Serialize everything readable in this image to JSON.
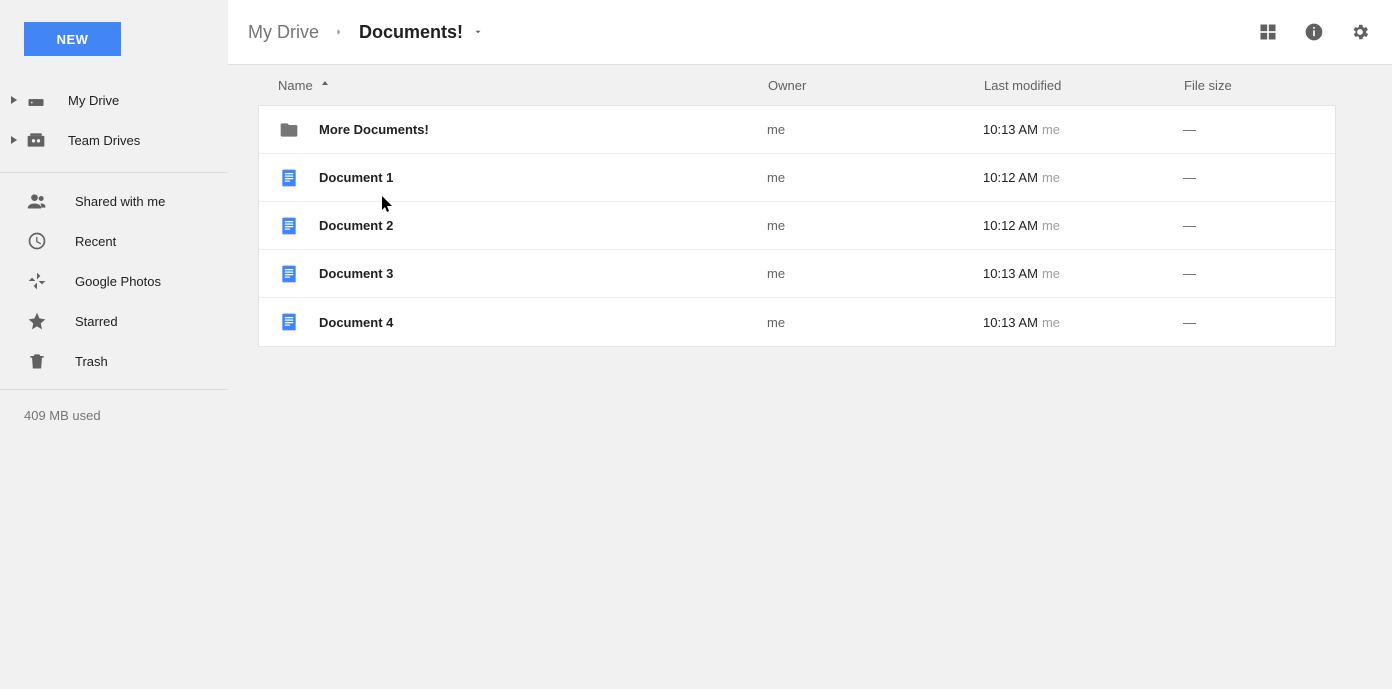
{
  "new_button": "NEW",
  "sidebar": {
    "tree": [
      {
        "label": "My Drive"
      },
      {
        "label": "Team Drives"
      }
    ],
    "items": [
      {
        "label": "Shared with me"
      },
      {
        "label": "Recent"
      },
      {
        "label": "Google Photos"
      },
      {
        "label": "Starred"
      },
      {
        "label": "Trash"
      }
    ],
    "storage": "409 MB used"
  },
  "breadcrumb": {
    "parent": "My Drive",
    "current": "Documents!"
  },
  "columns": {
    "name": "Name",
    "owner": "Owner",
    "modified": "Last modified",
    "size": "File size"
  },
  "rows": [
    {
      "type": "folder",
      "name": "More Documents!",
      "owner": "me",
      "modified": "10:13 AM",
      "modified_by": "me",
      "size": "—"
    },
    {
      "type": "doc",
      "name": "Document 1",
      "owner": "me",
      "modified": "10:12 AM",
      "modified_by": "me",
      "size": "—"
    },
    {
      "type": "doc",
      "name": "Document 2",
      "owner": "me",
      "modified": "10:12 AM",
      "modified_by": "me",
      "size": "—"
    },
    {
      "type": "doc",
      "name": "Document 3",
      "owner": "me",
      "modified": "10:13 AM",
      "modified_by": "me",
      "size": "—"
    },
    {
      "type": "doc",
      "name": "Document 4",
      "owner": "me",
      "modified": "10:13 AM",
      "modified_by": "me",
      "size": "—"
    }
  ]
}
